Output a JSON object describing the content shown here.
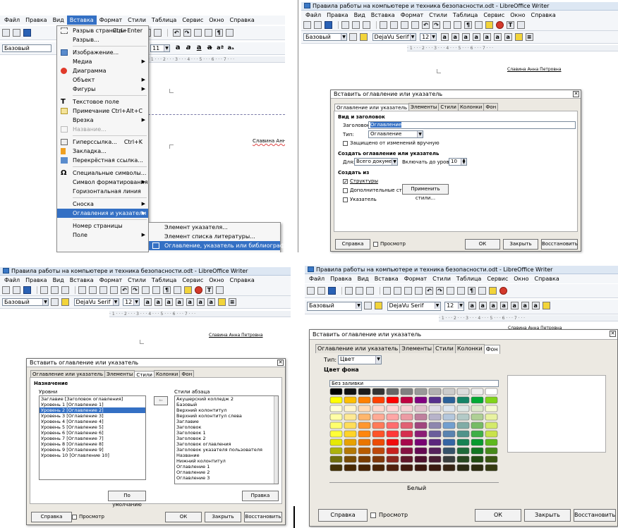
{
  "window_title": "Правила работы на компьютере и техника безопасности.odt - LibreOffice Writer",
  "menubar": [
    "Файл",
    "Правка",
    "Вид",
    "Вставка",
    "Формат",
    "Стили",
    "Таблица",
    "Сервис",
    "Окно",
    "Справка"
  ],
  "style_box": "Базовый",
  "font_box": "DejaVu Serif",
  "size_box": "12",
  "size_box_q1": "11",
  "author_text": "Славина Анна Петровна",
  "author_text_q1": "Славина Анна",
  "insert_menu": {
    "items": [
      {
        "label": "Разрыв страницы",
        "shortcut": "Ctrl+Enter"
      },
      {
        "label": "Разрыв..."
      },
      {
        "label": "Изображение..."
      },
      {
        "label": "Медиа"
      },
      {
        "label": "Диаграмма"
      },
      {
        "label": "Объект"
      },
      {
        "label": "Фигуры"
      },
      {
        "label": "Текстовое поле"
      },
      {
        "label": "Примечание",
        "shortcut": "Ctrl+Alt+C"
      },
      {
        "label": "Врезка"
      },
      {
        "label": "Название..."
      },
      {
        "label": "Гиперссылка...",
        "shortcut": "Ctrl+K"
      },
      {
        "label": "Закладка..."
      },
      {
        "label": "Перекрёстная ссылка..."
      },
      {
        "label": "Специальные символы..."
      },
      {
        "label": "Символ форматирования"
      },
      {
        "label": "Горизонтальная линия"
      },
      {
        "label": "Сноска"
      },
      {
        "label": "Оглавления и указатели"
      },
      {
        "label": "Номер страницы"
      },
      {
        "label": "Поле"
      }
    ],
    "submenu": [
      "Элемент указателя...",
      "Элемент списка литературы...",
      "Оглавление, указатель или библиография..."
    ]
  },
  "dialog": {
    "title": "Вставить оглавление или указатель",
    "tabs": [
      "Оглавление или указатель",
      "Элементы",
      "Стили",
      "Колонки",
      "Фон"
    ],
    "help": "Справка",
    "preview": "Просмотр",
    "ok": "ОК",
    "close": "Закрыть",
    "reset": "Восстановить"
  },
  "q2": {
    "section_type": "Вид и заголовок",
    "title_label": "Заголовок:",
    "title_value": "Оглавление",
    "type_label": "Тип:",
    "type_value": "Оглавление",
    "protected": "Защищено от изменений вручную",
    "section_create": "Создать оглавление или указатель",
    "for_label": "Для:",
    "for_value": "Всего документа",
    "levels_label": "Включать до уровня:",
    "levels_value": "10",
    "section_from": "Создать из",
    "structure": "Структуры",
    "additional_styles": "Дополнительные стили",
    "apply_styles": "Применить стили...",
    "index_marks": "Указатель"
  },
  "q3": {
    "heading": "Назначение",
    "levels_label": "Уровни",
    "levels": [
      "Заглавие [Заголовок оглавления]",
      "Уровень 1 [Оглавление 1]",
      "Уровень 2 [Оглавление 2]",
      "Уровень 3 [Оглавление 3]",
      "Уровень 4 [Оглавление 4]",
      "Уровень 5 [Оглавление 5]",
      "Уровень 6 [Оглавление 6]",
      "Уровень 7 [Оглавление 7]",
      "Уровень 8 [Оглавление 8]",
      "Уровень 9 [Оглавление 9]",
      "Уровень 10 [Оглавление 10]"
    ],
    "styles_label": "Стили абзаца",
    "styles": [
      "Акушерский колледж 2",
      "Базовый",
      "Верхний колонтитул",
      "Верхний колонтитул слева",
      "Заглавие",
      "Заголовок",
      "Заголовок 1",
      "Заголовок 2",
      "Заголовок оглавления",
      "Заголовок указателя пользователя",
      "Название",
      "Нижний колонтитул",
      "Оглавление 1",
      "Оглавление 2",
      "Оглавление 3"
    ],
    "default_btn": "По умолчанию",
    "edit_btn": "Правка"
  },
  "q4": {
    "type_label": "Тип:",
    "type_value": "Цвет",
    "section": "Цвет фона",
    "no_fill": "Без заливки",
    "selected_color": "Белый"
  },
  "colors": {
    "accent": "#3470c4",
    "titlebar": "#dde7f3",
    "dialog_bg": "#ece9e2"
  }
}
